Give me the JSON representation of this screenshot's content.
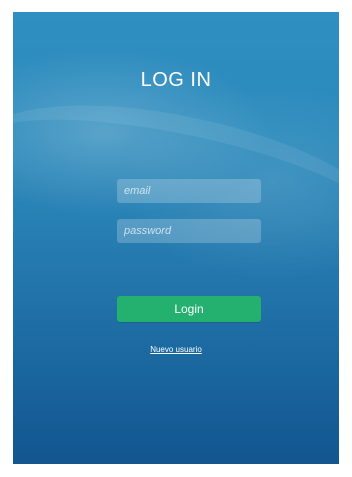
{
  "page": {
    "title": "LOG IN"
  },
  "form": {
    "email": {
      "value": "",
      "placeholder": "email"
    },
    "password": {
      "value": "",
      "placeholder": "password"
    },
    "login_button": "Login",
    "new_user_link": "Nuevo usuario"
  },
  "colors": {
    "background_top": "#2f8fc0",
    "background_bottom": "#12558f",
    "button": "#24b16f",
    "text": "#ffffff"
  }
}
